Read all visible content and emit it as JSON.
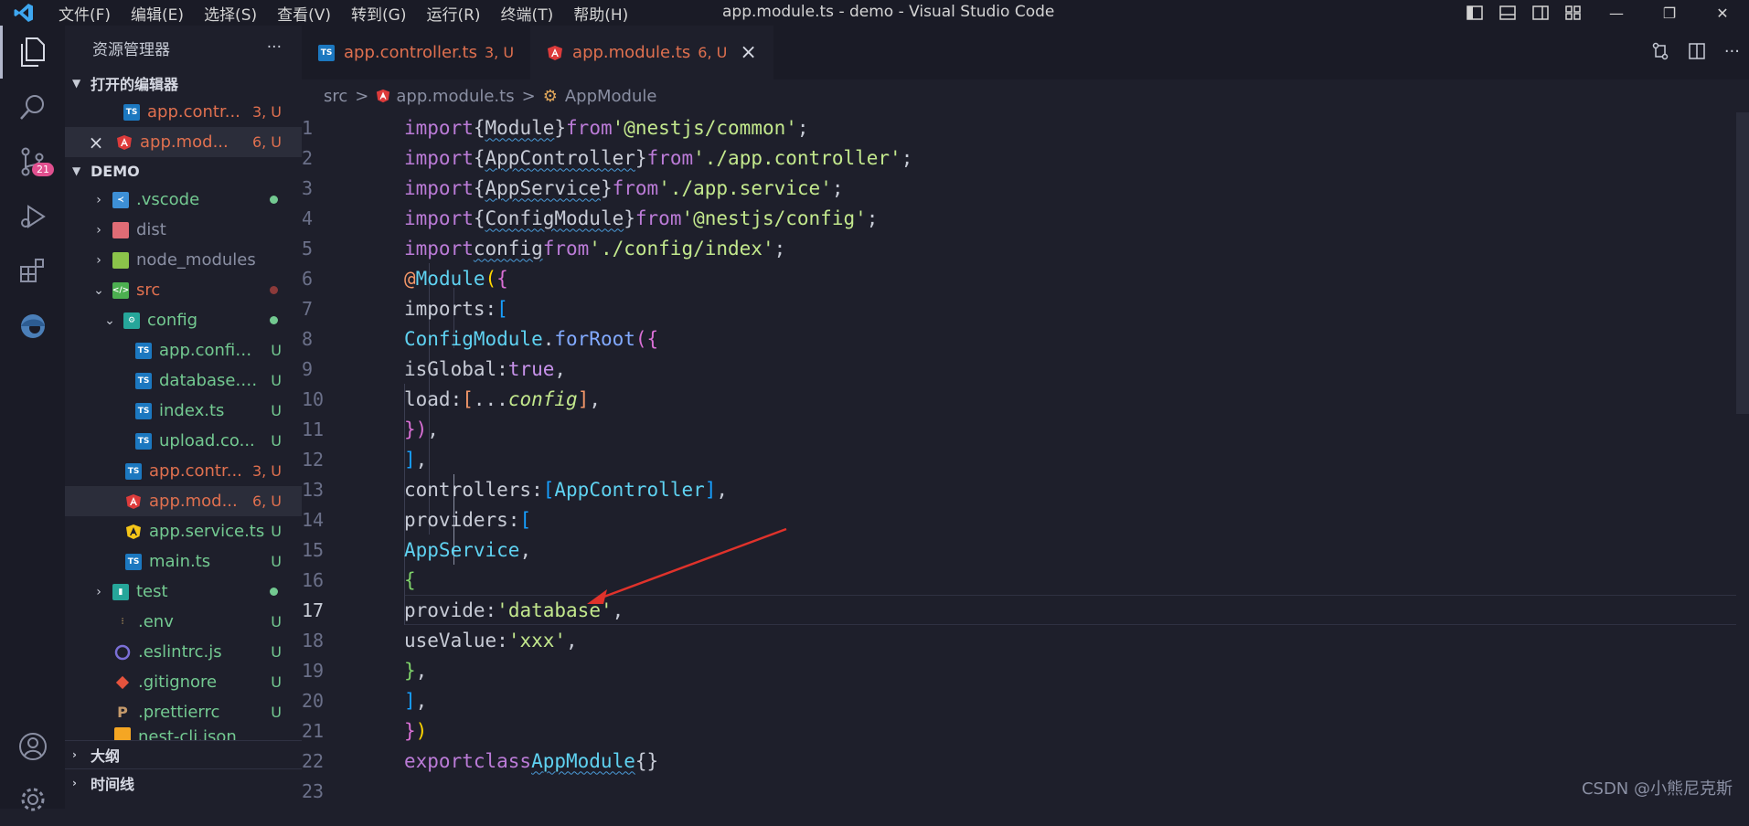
{
  "titlebar": {
    "menu": [
      "文件(F)",
      "编辑(E)",
      "选择(S)",
      "查看(V)",
      "转到(G)",
      "运行(R)",
      "终端(T)",
      "帮助(H)"
    ],
    "title": "app.module.ts - demo - Visual Studio Code"
  },
  "activity": {
    "scm_badge": "21"
  },
  "sidebar": {
    "title": "资源管理器",
    "more": "···",
    "open_editors": {
      "label": "打开的编辑器",
      "items": [
        {
          "name": "app.contr...",
          "meta": "3, U"
        },
        {
          "close": "×",
          "name": "app.mod...",
          "meta": "6, U"
        }
      ]
    },
    "demo": {
      "label": "DEMO",
      "items": [
        {
          "name": ".vscode"
        },
        {
          "name": "dist"
        },
        {
          "name": "node_modules"
        },
        {
          "name": "src"
        },
        {
          "name": "config"
        },
        {
          "name": "app.config...",
          "meta": "U"
        },
        {
          "name": "database.c...",
          "meta": "U"
        },
        {
          "name": "index.ts",
          "meta": "U"
        },
        {
          "name": "upload.co...",
          "meta": "U"
        },
        {
          "name": "app.contr...",
          "meta": "3, U"
        },
        {
          "name": "app.mod...",
          "meta": "6, U"
        },
        {
          "name": "app.service.ts",
          "meta": "U"
        },
        {
          "name": "main.ts",
          "meta": "U"
        },
        {
          "name": "test"
        },
        {
          "name": ".env",
          "meta": "U"
        },
        {
          "name": ".eslintrc.js",
          "meta": "U"
        },
        {
          "name": ".gitignore",
          "meta": "U"
        },
        {
          "name": ".prettierrc",
          "meta": "U"
        },
        {
          "name": "nest-cli.json",
          "meta": "U"
        }
      ]
    },
    "outline": "大纲",
    "timeline": "时间线"
  },
  "tabs": [
    {
      "label": "app.controller.ts",
      "meta": "3, U"
    },
    {
      "label": "app.module.ts",
      "meta": "6, U",
      "close": "×"
    }
  ],
  "breadcrumb": {
    "src": "src",
    "sep": ">",
    "file": "app.module.ts",
    "symbol": "AppModule"
  },
  "editor": {
    "line_numbers": [
      "1",
      "2",
      "3",
      "4",
      "5",
      "6",
      "7",
      "8",
      "9",
      "10",
      "11",
      "12",
      "13",
      "14",
      "15",
      "16",
      "17",
      "18",
      "19",
      "20",
      "21",
      "22",
      "23"
    ],
    "current_line": "17"
  },
  "watermark": "CSDN @小熊尼克斯",
  "colors": {
    "accent": "#e0704f",
    "git_untracked": "#73c991",
    "badge": "#e0508f"
  }
}
